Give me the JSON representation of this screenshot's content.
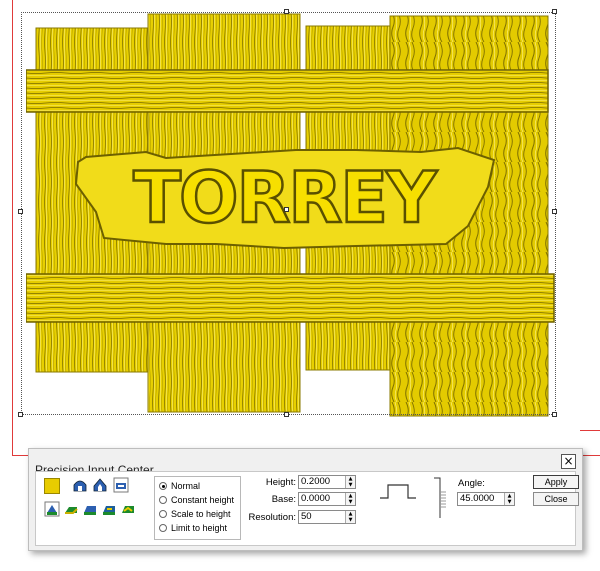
{
  "artwork": {
    "name": "wooden-sign-relief",
    "text": "TORREY",
    "colors": {
      "wood": "#e6cf00",
      "wood_light": "#f6e41e",
      "wood_dark": "#8a7a00",
      "letters": "#f2d800",
      "outline": "#5a5000"
    }
  },
  "dialog": {
    "title": "Precision Input Center",
    "close_icon": "×",
    "radio_options": [
      {
        "label": "Normal",
        "selected": true
      },
      {
        "label": "Constant height",
        "selected": false
      },
      {
        "label": "Scale to height",
        "selected": false
      },
      {
        "label": "Limit to height",
        "selected": false
      }
    ],
    "fields": {
      "height": {
        "label": "Height:",
        "value": "0.2000"
      },
      "base": {
        "label": "Base:",
        "value": "0.0000"
      },
      "resolution": {
        "label": "Resolution:",
        "value": "50"
      },
      "angle": {
        "label": "Angle:",
        "value": "45.0000"
      }
    },
    "buttons": {
      "apply": "Apply",
      "close": "Close"
    },
    "spin_arrows": {
      "up": "▲",
      "down": "▼"
    },
    "tool_icons": [
      "color-swatch-icon",
      "round-profile-icon",
      "pointed-profile-icon",
      "flat-profile-icon",
      "merge-high-icon",
      "merge-low-icon",
      "add-icon",
      "subtract-icon",
      "no-merge-icon"
    ]
  }
}
